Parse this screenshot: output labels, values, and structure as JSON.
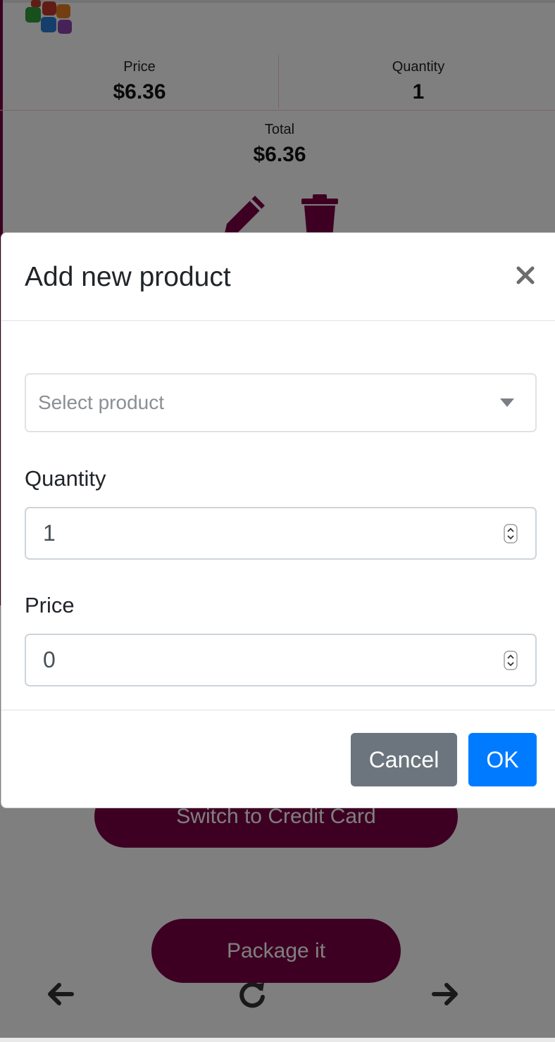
{
  "background": {
    "summary": {
      "price_label": "Price",
      "price_value": "$6.36",
      "quantity_label": "Quantity",
      "quantity_value": "1",
      "total_label": "Total",
      "total_value": "$6.36"
    },
    "actions": {
      "edit_icon": "pencil-icon",
      "delete_icon": "trash-icon"
    },
    "switch_button": "Switch to Credit Card",
    "package_button": "Package it",
    "nav": {
      "back_icon": "arrow-left-icon",
      "refresh_icon": "refresh-icon",
      "forward_icon": "arrow-right-icon"
    }
  },
  "modal": {
    "title": "Add new product",
    "close_icon": "close-icon",
    "product_select": {
      "placeholder": "Select product"
    },
    "quantity": {
      "label": "Quantity",
      "value": "1"
    },
    "price": {
      "label": "Price",
      "value": "0"
    },
    "cancel_label": "Cancel",
    "ok_label": "OK"
  },
  "colors": {
    "accent": "#7b0044",
    "primary": "#007bff",
    "secondary": "#6c757d"
  }
}
